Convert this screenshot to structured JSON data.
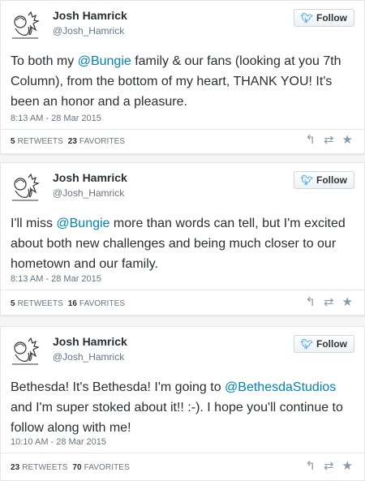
{
  "tweets": [
    {
      "name": "Josh Hamrick",
      "handle": "@Josh_Hamrick",
      "follow_label": "Follow",
      "text_parts": {
        "a": "To both my ",
        "mention": "@Bungie",
        "b": " family & our fans (looking at you 7th Column), from the bottom of my heart, THANK YOU! It's been an honor and a pleasure."
      },
      "timestamp": "8:13 AM - 28 Mar 2015",
      "retweets": "5",
      "retweets_label": "RETWEETS",
      "favorites": "23",
      "favorites_label": "FAVORITES"
    },
    {
      "name": "Josh Hamrick",
      "handle": "@Josh_Hamrick",
      "follow_label": "Follow",
      "text_parts": {
        "a": "I'll miss ",
        "mention": "@Bungie",
        "b": " more than words can tell, but I'm excited about both new challenges and being much closer to our hometown and our family."
      },
      "timestamp": "8:13 AM - 28 Mar 2015",
      "retweets": "5",
      "retweets_label": "RETWEETS",
      "favorites": "16",
      "favorites_label": "FAVORITES"
    },
    {
      "name": "Josh Hamrick",
      "handle": "@Josh_Hamrick",
      "follow_label": "Follow",
      "text_parts": {
        "a": "Bethesda! It's Bethesda! I'm going to ",
        "mention": "@BethesdaStudios",
        "b": " and I'm super stoked about it!!  :-). I hope you'll continue to follow along with me!"
      },
      "timestamp": "10:10 AM - 28 Mar 2015",
      "retweets": "23",
      "retweets_label": "RETWEETS",
      "favorites": "70",
      "favorites_label": "FAVORITES"
    }
  ],
  "icons": {
    "follow": "twitter-bird-icon",
    "reply": "reply-icon",
    "retweet": "retweet-icon",
    "favorite": "star-icon",
    "avatar": "avatar-illustration"
  },
  "colors": {
    "link": "#0084b4",
    "bird": "#55acee",
    "muted": "#66757f",
    "icon": "#8899a6"
  }
}
